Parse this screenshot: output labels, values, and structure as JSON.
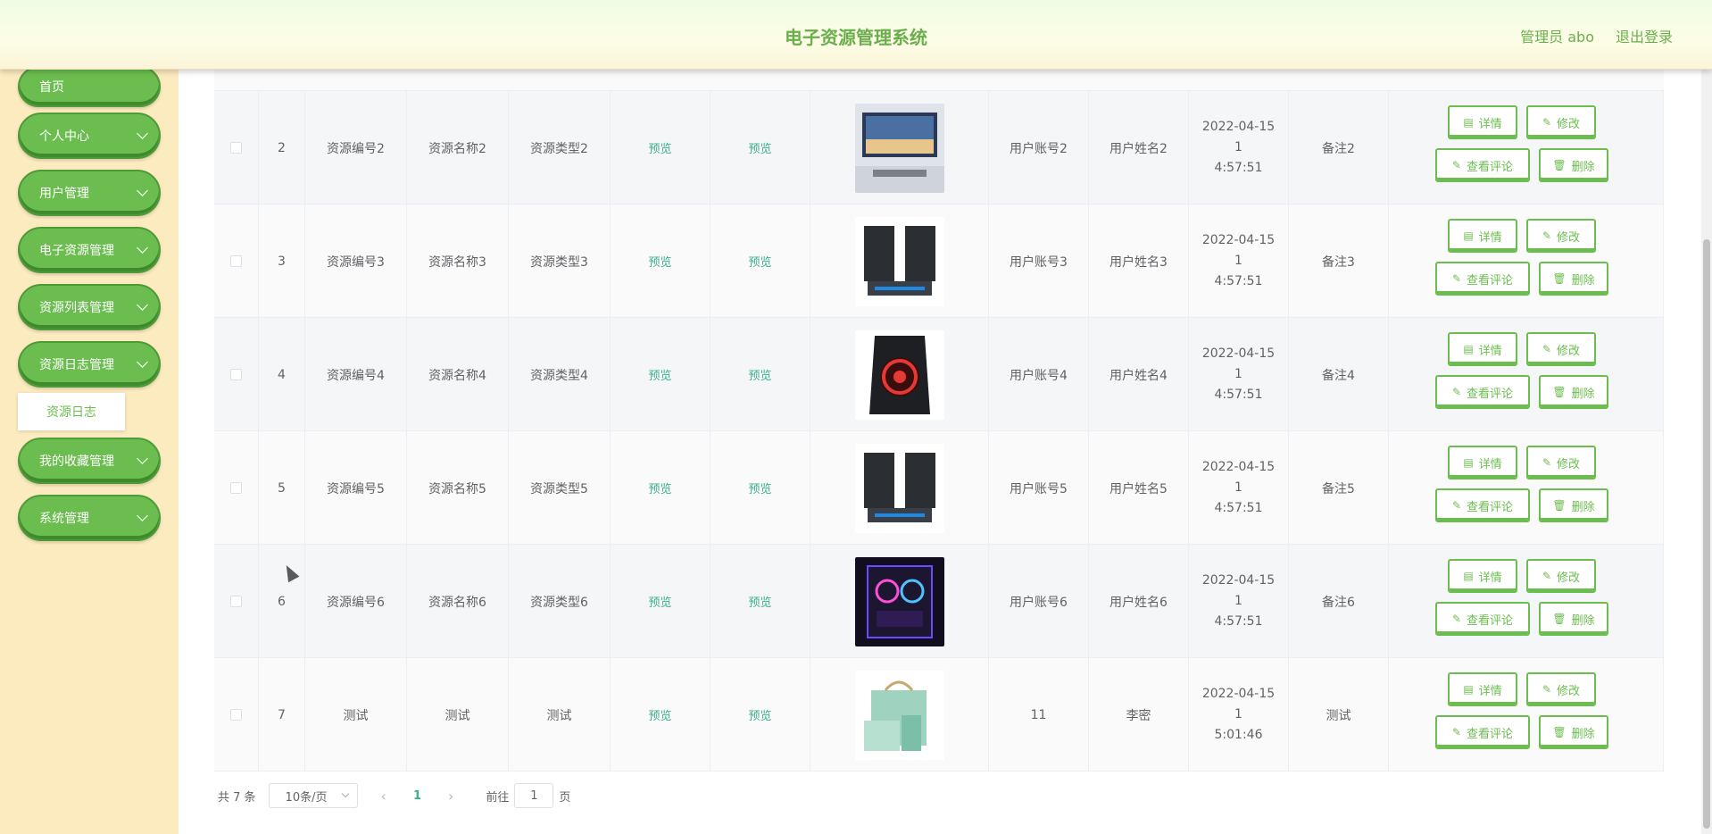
{
  "header": {
    "title": "电子资源管理系统",
    "user": "管理员 abo",
    "logout": "退出登录"
  },
  "sidebar": {
    "items": [
      {
        "label": "首页",
        "has_chevron": false
      },
      {
        "label": "个人中心",
        "has_chevron": true
      },
      {
        "label": "用户管理",
        "has_chevron": true
      },
      {
        "label": "电子资源管理",
        "has_chevron": true
      },
      {
        "label": "资源列表管理",
        "has_chevron": true
      },
      {
        "label": "资源日志管理",
        "has_chevron": true
      },
      {
        "label": "我的收藏管理",
        "has_chevron": true
      },
      {
        "label": "系统管理",
        "has_chevron": true
      }
    ],
    "submenu": "资源日志"
  },
  "table": {
    "rows": [
      {
        "index": "2",
        "code": "资源编号2",
        "name": "资源名称2",
        "type": "资源类型2",
        "preview1": "预览",
        "preview2": "预览",
        "image": "living-room-tv",
        "account": "用户账号2",
        "username": "用户姓名2",
        "time_line1": "2022-04-15 1",
        "time_line2": "4:57:51",
        "note": "备注2"
      },
      {
        "index": "3",
        "code": "资源编号3",
        "name": "资源名称3",
        "type": "资源类型3",
        "preview1": "预览",
        "preview2": "预览",
        "image": "speakers",
        "account": "用户账号3",
        "username": "用户姓名3",
        "time_line1": "2022-04-15 1",
        "time_line2": "4:57:51",
        "note": "备注3"
      },
      {
        "index": "4",
        "code": "资源编号4",
        "name": "资源名称4",
        "type": "资源类型4",
        "preview1": "预览",
        "preview2": "预览",
        "image": "pc-case-red",
        "account": "用户账号4",
        "username": "用户姓名4",
        "time_line1": "2022-04-15 1",
        "time_line2": "4:57:51",
        "note": "备注4"
      },
      {
        "index": "5",
        "code": "资源编号5",
        "name": "资源名称5",
        "type": "资源类型5",
        "preview1": "预览",
        "preview2": "预览",
        "image": "speakers",
        "account": "用户账号5",
        "username": "用户姓名5",
        "time_line1": "2022-04-15 1",
        "time_line2": "4:57:51",
        "note": "备注5"
      },
      {
        "index": "6",
        "code": "资源编号6",
        "name": "资源名称6",
        "type": "资源类型6",
        "preview1": "预览",
        "preview2": "预览",
        "image": "pc-rgb",
        "account": "用户账号6",
        "username": "用户姓名6",
        "time_line1": "2022-04-15 1",
        "time_line2": "4:57:51",
        "note": "备注6"
      },
      {
        "index": "7",
        "code": "测试",
        "name": "测试",
        "type": "测试",
        "preview1": "预览",
        "preview2": "预览",
        "image": "gift-box",
        "account": "11",
        "username": "李密",
        "time_line1": "2022-04-15 1",
        "time_line2": "5:01:46",
        "note": "测试"
      }
    ],
    "actions": {
      "detail": "详情",
      "edit": "修改",
      "comments": "查看评论",
      "delete": "删除"
    }
  },
  "pagination": {
    "total": "共 7 条",
    "page_size": "10条/页",
    "current_page": "1",
    "goto_prefix": "前往",
    "goto_value": "1",
    "goto_suffix": "页"
  },
  "colors": {
    "accent": "#6cbd4f",
    "link": "#3bb08f",
    "sidebar_bg": "#fdebc0"
  }
}
